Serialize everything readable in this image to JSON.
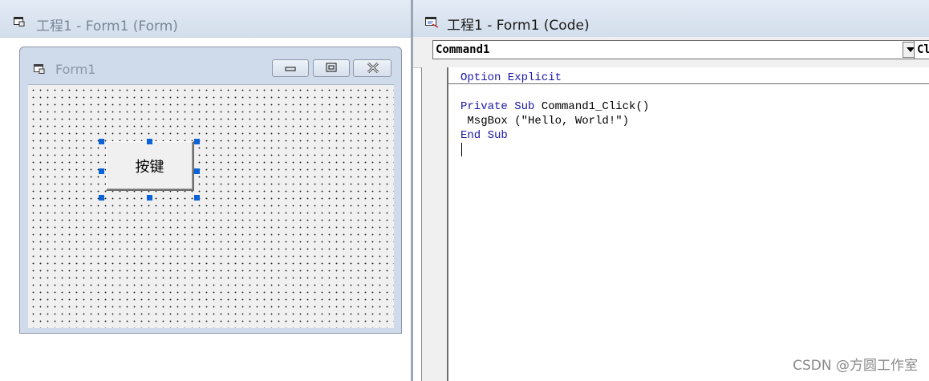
{
  "form_window": {
    "title": "工程1 - Form1 (Form)",
    "icon": "form-window-icon"
  },
  "designer": {
    "form_caption": "Form1",
    "caption_buttons": [
      "minimize-icon",
      "restore-icon",
      "close-icon"
    ],
    "command_button": {
      "caption": "按键",
      "selected": true
    }
  },
  "code_window": {
    "title": "工程1 - Form1 (Code)",
    "icon": "code-window-icon",
    "object_combo": {
      "value": "Command1"
    },
    "procedure_combo": {
      "value": "Cl"
    },
    "code": {
      "line1_kw": "Option Explicit",
      "line2_kw1": "Private Sub",
      "line2_tx": " Command1_Click()",
      "line3_tx": " MsgBox (\"Hello, World!\")",
      "line4_kw": "End Sub"
    }
  },
  "watermark": "CSDN @方圆工作室",
  "colors": {
    "keyword": "#1a16a8",
    "selection_handle": "#0a64d8",
    "titlebar": "#d3deec"
  }
}
